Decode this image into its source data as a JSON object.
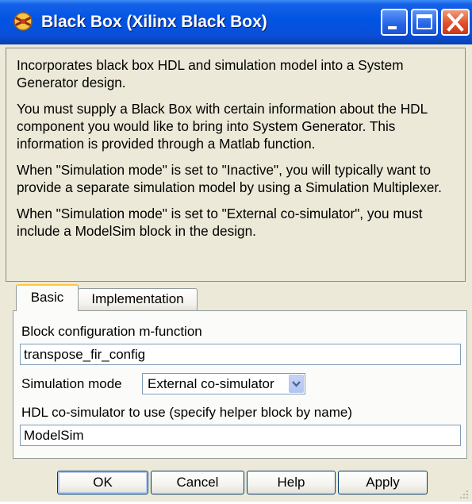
{
  "window": {
    "title": "Black Box (Xilinx Black Box)",
    "icon": "xilinx-block-icon"
  },
  "description": {
    "paragraphs": [
      "Incorporates black box HDL and simulation model into a System Generator design.",
      "You must supply a Black Box with certain information about the HDL component you would like to bring into System Generator. This information is provided through a Matlab function.",
      "When \"Simulation mode\" is set to \"Inactive\", you will typically want to provide a separate simulation model by using a Simulation Multiplexer.",
      "When \"Simulation mode\" is set to \"External co-simulator\", you must include a ModelSim block in the design."
    ]
  },
  "tabs": [
    {
      "label": "Basic",
      "selected": true
    },
    {
      "label": "Implementation",
      "selected": false
    }
  ],
  "basic": {
    "config_label": "Block configuration m-function",
    "config_value": "transpose_fir_config",
    "sim_mode_label": "Simulation mode",
    "sim_mode_value": "External co-simulator",
    "cosim_label": "HDL co-simulator to use (specify helper block by name)",
    "cosim_value": "ModelSim"
  },
  "buttons": {
    "ok": "OK",
    "cancel": "Cancel",
    "help": "Help",
    "apply": "Apply"
  },
  "colors": {
    "titlebar": "#0054e3",
    "dialog_bg": "#ece9d8",
    "close_button": "#e0502a",
    "tab_highlight": "#ffc83c"
  }
}
